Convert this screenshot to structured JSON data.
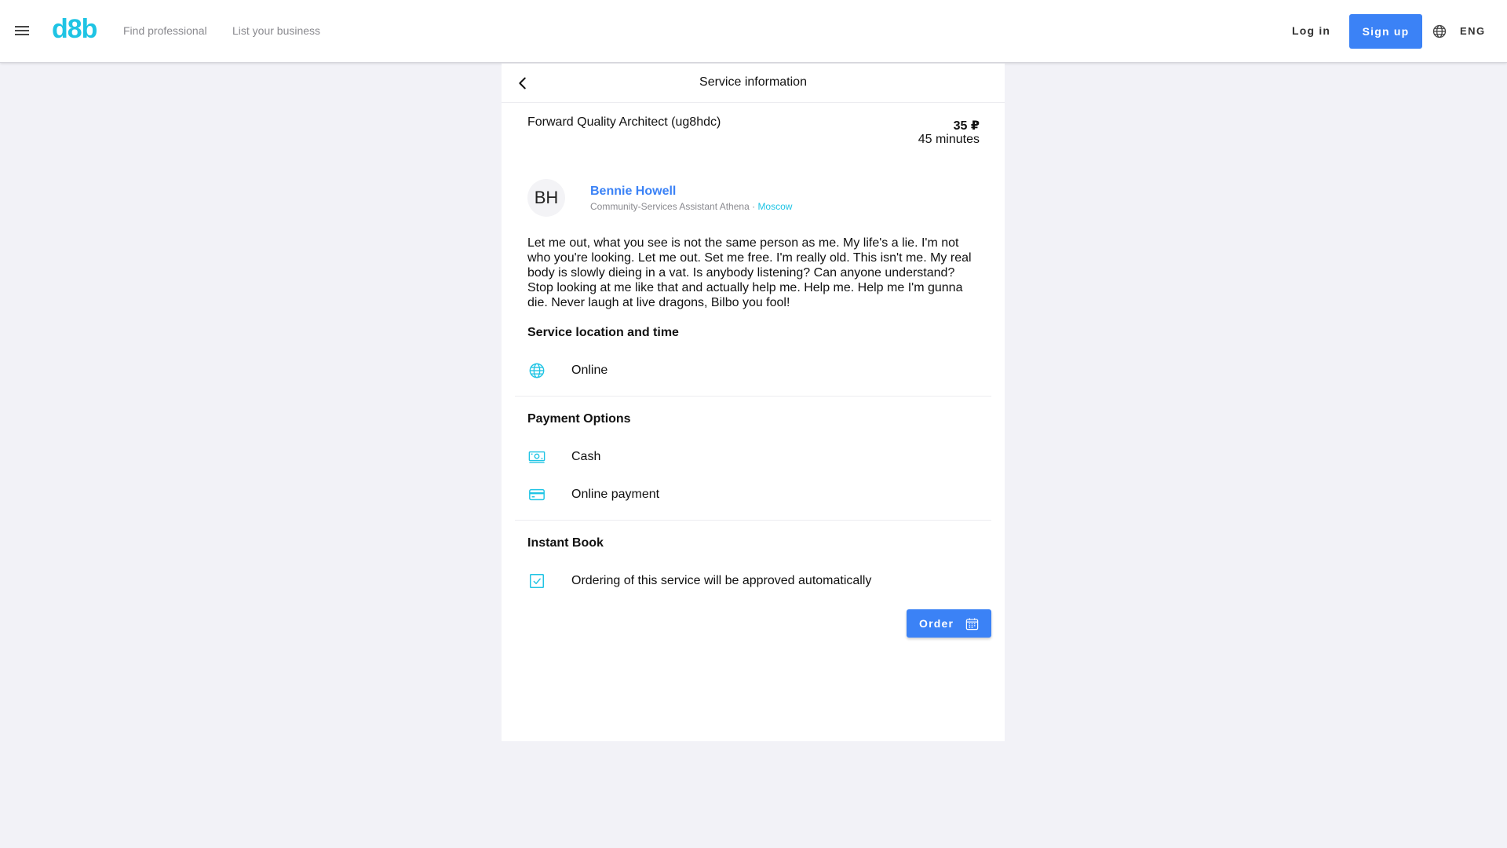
{
  "header": {
    "logo": "d8b",
    "nav": {
      "find": "Find professional",
      "list": "List your business"
    },
    "login": "Log in",
    "signup": "Sign up",
    "language": "ENG"
  },
  "card": {
    "title": "Service information",
    "service_name": "Forward Quality Architect (ug8hdc)",
    "price": "35 ₽",
    "duration": "45 minutes",
    "professional": {
      "initials": "BH",
      "name": "Bennie Howell",
      "role": "Community-Services Assistant Athena",
      "separator": " · ",
      "city": "Moscow"
    },
    "description": "Let me out, what you see is not the same person as me. My life's a lie. I'm not who you're looking. Let me out. Set me free. I'm really old. This isn't me. My real body is slowly dieing in a vat. Is anybody listening? Can anyone understand? Stop looking at me like that and actually help me. Help me. Help me I'm gunna die. Never laugh at live dragons, Bilbo you fool!",
    "location": {
      "heading": "Service location and time",
      "items": [
        {
          "icon": "globe-icon",
          "label": "Online"
        }
      ]
    },
    "payment": {
      "heading": "Payment Options",
      "items": [
        {
          "icon": "cash-icon",
          "label": "Cash"
        },
        {
          "icon": "credit-card-icon",
          "label": "Online payment"
        }
      ]
    },
    "instant_book": {
      "heading": "Instant Book",
      "items": [
        {
          "icon": "checkbox-checked-icon",
          "label": "Ordering of this service will be approved automatically"
        }
      ]
    },
    "order_button": "Order"
  },
  "colors": {
    "accent": "#3b82f6",
    "brand": "#1fc4e4",
    "background": "#f2f2f7"
  }
}
